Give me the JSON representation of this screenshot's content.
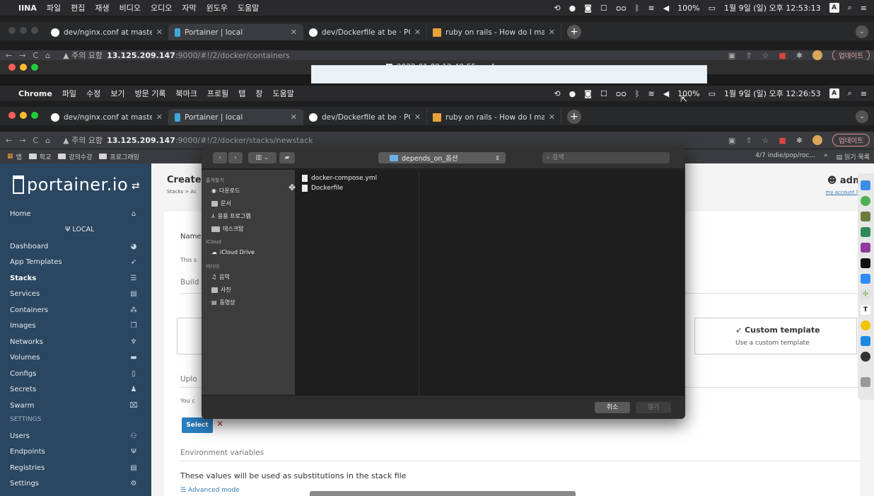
{
  "outer": {
    "menubar": {
      "app": "IINA",
      "menus": [
        "파일",
        "편집",
        "재생",
        "비디오",
        "오디오",
        "자막",
        "윈도우",
        "도움말"
      ],
      "battery": "100%",
      "clock": "1월 9일 (일) 오후 12:53:13",
      "input_method": "A"
    },
    "tabs": [
      {
        "title": "dev/nginx.conf at master · POPPY-I",
        "active": false
      },
      {
        "title": "Portainer | local",
        "active": true
      },
      {
        "title": "dev/Dockerfile at be · POPPY-I",
        "active": false
      },
      {
        "title": "ruby on rails - How do I make",
        "active": false
      }
    ],
    "address": {
      "warning": "주의 요함",
      "host": "13.125.209.147",
      "path": ":9000/#!/2/docker/containers"
    },
    "update_label": "업데이트",
    "video_filename": "2022-01-09 12-48-55.mp4"
  },
  "inner": {
    "menubar": {
      "app": "Chrome",
      "menus": [
        "파일",
        "수정",
        "보기",
        "방문 기록",
        "북마크",
        "프로필",
        "탭",
        "창",
        "도움말"
      ],
      "battery": "100%",
      "clock": "1월 9일 (일) 오후 12:26:53",
      "input_method": "A"
    },
    "tabs": [
      {
        "title": "dev/nginx.conf at master · POPPY-I",
        "active": false
      },
      {
        "title": "Portainer | local",
        "active": true
      },
      {
        "title": "dev/Dockerfile at be · POPPY-I",
        "active": false
      },
      {
        "title": "ruby on rails - How do I make",
        "active": false
      }
    ],
    "address": {
      "warning": "주의 요함",
      "host": "13.125.209.147",
      "path": ":9000/#!/2/docker/stacks/newstack"
    },
    "update_label": "업데이트",
    "bookmarks": [
      "앱",
      "학교",
      "강의수강",
      "프로그래밍"
    ],
    "bookmark_right": "4/7 indie/pop/roc...",
    "reading_list": "읽기 목록"
  },
  "sidebar": {
    "logo": "portainer.io",
    "home": "Home",
    "endpoint": "LOCAL",
    "items": [
      {
        "label": "Dashboard",
        "icon": "tachometer-icon",
        "glyph": "◕",
        "bold": false
      },
      {
        "label": "App Templates",
        "icon": "rocket-icon",
        "glyph": "➶",
        "bold": false
      },
      {
        "label": "Stacks",
        "icon": "th-list-icon",
        "glyph": "☰",
        "bold": true
      },
      {
        "label": "Services",
        "icon": "list-alt-icon",
        "glyph": "▤",
        "bold": false
      },
      {
        "label": "Containers",
        "icon": "cubes-icon",
        "glyph": "⁂",
        "bold": false
      },
      {
        "label": "Images",
        "icon": "clone-icon",
        "glyph": "❐",
        "bold": false
      },
      {
        "label": "Networks",
        "icon": "sitemap-icon",
        "glyph": "♆",
        "bold": false
      },
      {
        "label": "Volumes",
        "icon": "hdd-icon",
        "glyph": "▬",
        "bold": false
      },
      {
        "label": "Configs",
        "icon": "file-code-icon",
        "glyph": "▯",
        "bold": false
      },
      {
        "label": "Secrets",
        "icon": "user-secret-icon",
        "glyph": "♟",
        "bold": false
      },
      {
        "label": "Swarm",
        "icon": "object-group-icon",
        "glyph": "⌧",
        "bold": false
      }
    ],
    "settings_heading": "SETTINGS",
    "settings_items": [
      {
        "label": "Users",
        "icon": "users-icon",
        "glyph": "⚇"
      },
      {
        "label": "Endpoints",
        "icon": "plug-icon",
        "glyph": "Ψ"
      },
      {
        "label": "Registries",
        "icon": "database-icon",
        "glyph": "▤"
      },
      {
        "label": "Settings",
        "icon": "cogs-icon",
        "glyph": "⚙"
      }
    ]
  },
  "main": {
    "title": "Create",
    "breadcrumb": "Stacks > Ac",
    "user": "admi",
    "account_links": "my account  log o",
    "name_label": "Name",
    "this_text": "This s",
    "build_heading": "Build",
    "custom_template_title": "Custom template",
    "custom_template_sub": "Use a custom template",
    "upload_heading": "Uplo",
    "you_text": "You c",
    "select_file": "Select file",
    "env_heading": "Environment variables",
    "env_desc": "These values will be used as substitutions in the stack file",
    "advanced_mode": "Advanced mode"
  },
  "dialog": {
    "folder": "depends_on_옵션",
    "search_placeholder": "검색",
    "favorites_heading": "즐겨찾기",
    "favorites": [
      "다운로드",
      "문서",
      "응용 프로그램",
      "데스크탑"
    ],
    "icloud_heading": "iCloud",
    "icloud": [
      "iCloud Drive"
    ],
    "media_heading": "미디어",
    "media": [
      "음악",
      "사진",
      "동영상"
    ],
    "files": [
      "docker-compose.yml",
      "Dockerfile"
    ],
    "cancel": "취소",
    "open": "열기"
  }
}
